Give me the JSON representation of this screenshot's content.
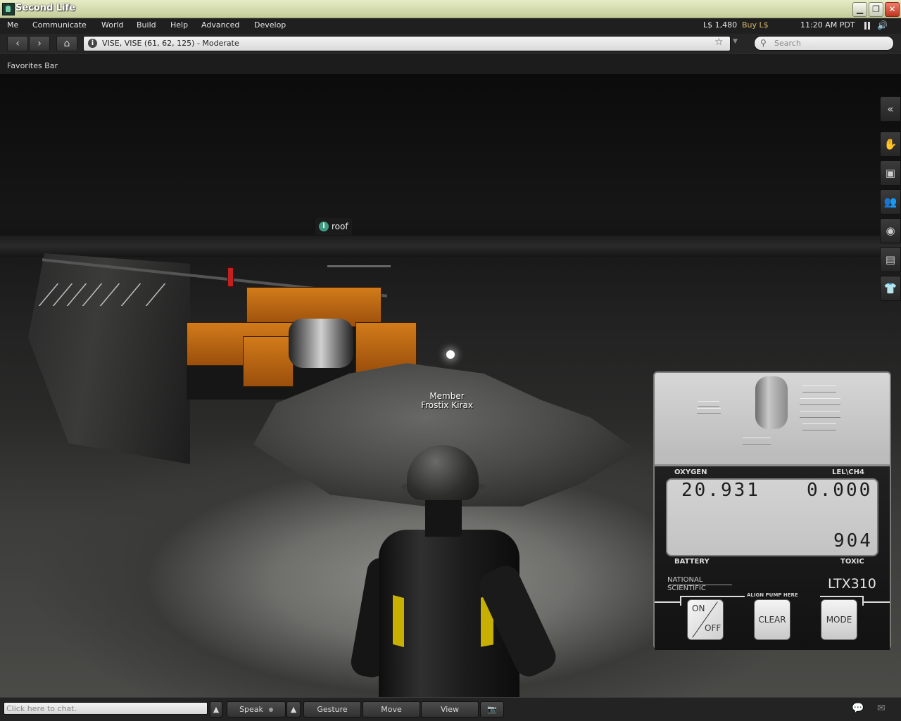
{
  "window": {
    "title": "Second Life"
  },
  "menu": {
    "items": [
      "Me",
      "Communicate",
      "World",
      "Build",
      "Help",
      "Advanced",
      "Develop"
    ]
  },
  "status": {
    "balance": "L$ 1,480",
    "buy_label": "Buy L$",
    "time": "11:20 AM PDT"
  },
  "navbar": {
    "location": "VISE, VISE (61, 62, 125) - Moderate",
    "search_placeholder": "Search"
  },
  "favorites": {
    "label": "Favorites Bar"
  },
  "scene": {
    "object_tag": "roof",
    "avatar_group": "Member",
    "avatar_name": "Frostix Kirax"
  },
  "detector": {
    "oxygen_label": "OXYGEN",
    "lel_label": "LEL\\CH4",
    "oxygen_value": "20.931",
    "lel_value": "0.000",
    "toxic_value": "904",
    "battery_label": "BATTERY",
    "toxic_label": "TOXIC",
    "brand_line1": "NATIONAL",
    "brand_line2": "SCIENTIFIC",
    "model": "LTX310",
    "align_label": "ALIGN PUMP HERE",
    "on_label": "ON",
    "off_label": "OFF",
    "clear_label": "CLEAR",
    "mode_label": "MODE"
  },
  "bottombar": {
    "chat_placeholder": "Click here to chat.",
    "speak": "Speak",
    "gesture": "Gesture",
    "move": "Move",
    "view": "View"
  },
  "sidebar_icons": [
    "collapse-icon",
    "hand-icon",
    "profile-icon",
    "people-icon",
    "places-icon",
    "inventory-icon",
    "appearance-icon"
  ]
}
